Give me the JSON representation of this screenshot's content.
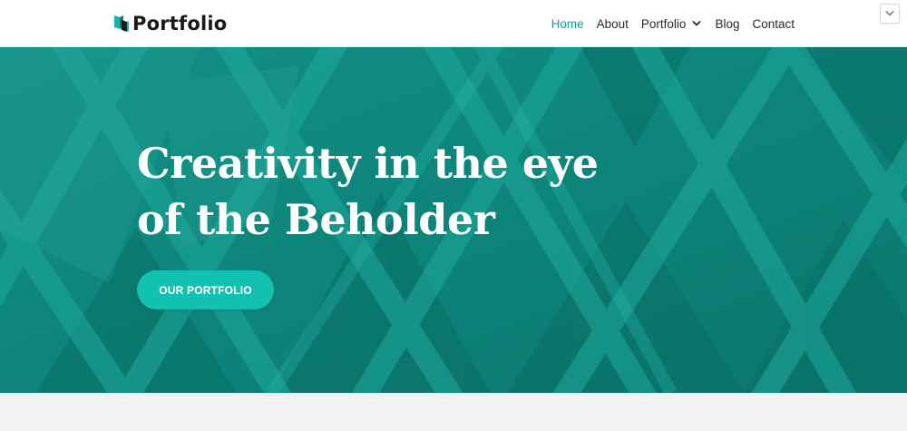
{
  "brand": {
    "name": "Portfolio",
    "logo_icon": "stacked-blocks-icon"
  },
  "nav": {
    "items": [
      {
        "label": "Home",
        "active": true
      },
      {
        "label": "About",
        "active": false
      },
      {
        "label": "Portfolio",
        "active": false,
        "has_dropdown": true
      },
      {
        "label": "Blog",
        "active": false
      },
      {
        "label": "Contact",
        "active": false
      }
    ]
  },
  "hero": {
    "title_line1": "Creativity in the eye",
    "title_line2": "of the Beholder",
    "button_label": "OUR PORTFOLIO"
  },
  "colors": {
    "accent": "#169c8f",
    "hero_bg": "#0f8a80",
    "button": "#13c1b1",
    "header_bg": "#ffffff",
    "footer_bg": "#f2f2f2"
  }
}
